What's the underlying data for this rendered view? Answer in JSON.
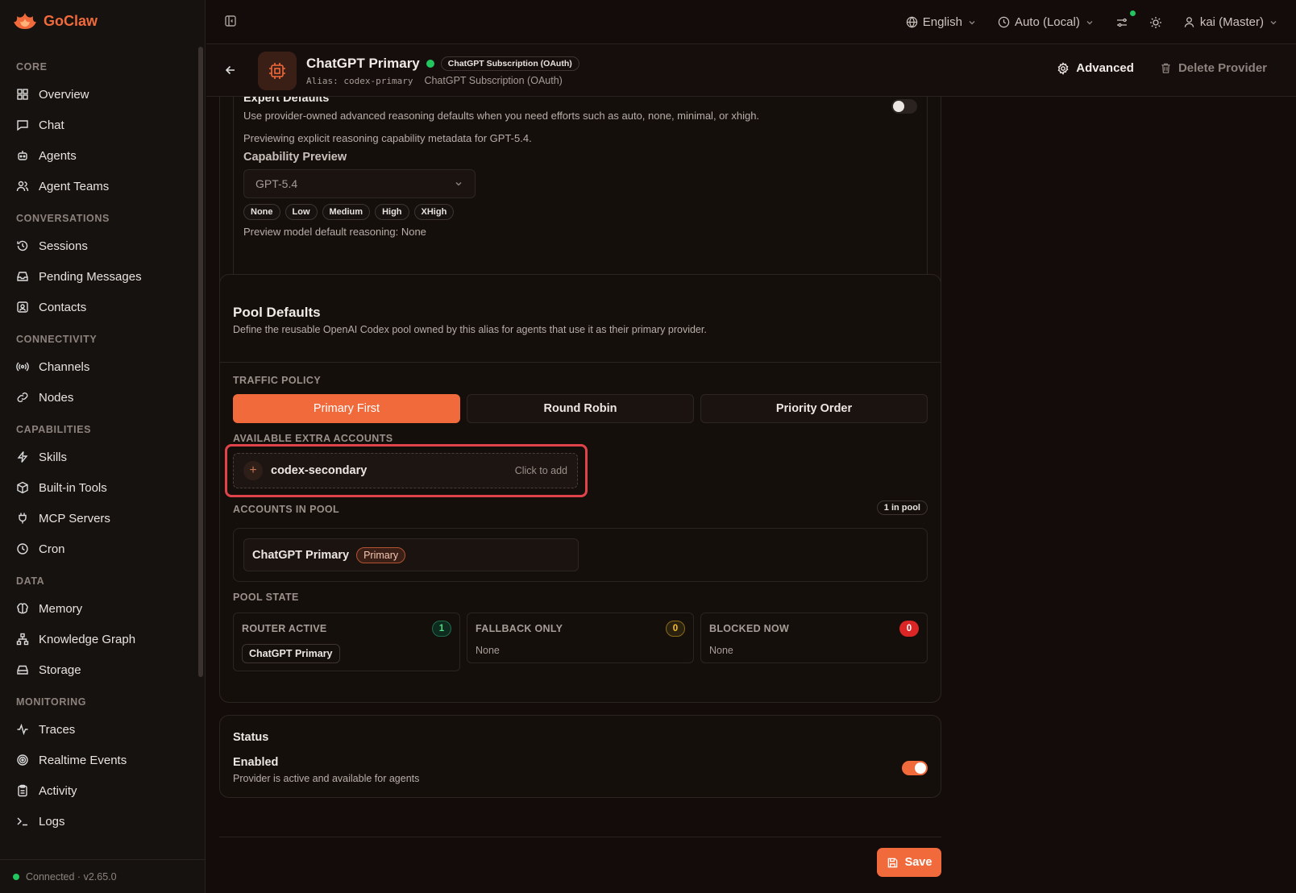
{
  "app": {
    "brand": "GoClaw",
    "connection": "Connected · v2.65.0"
  },
  "sidebar": {
    "sections": [
      {
        "title": "CORE",
        "items": [
          "Overview",
          "Chat",
          "Agents",
          "Agent Teams"
        ]
      },
      {
        "title": "CONVERSATIONS",
        "items": [
          "Sessions",
          "Pending Messages",
          "Contacts"
        ]
      },
      {
        "title": "CONNECTIVITY",
        "items": [
          "Channels",
          "Nodes"
        ]
      },
      {
        "title": "CAPABILITIES",
        "items": [
          "Skills",
          "Built-in Tools",
          "MCP Servers",
          "Cron"
        ]
      },
      {
        "title": "DATA",
        "items": [
          "Memory",
          "Knowledge Graph",
          "Storage"
        ]
      },
      {
        "title": "MONITORING",
        "items": [
          "Traces",
          "Realtime Events",
          "Activity",
          "Logs"
        ]
      }
    ]
  },
  "topbar": {
    "language": "English",
    "timezone": "Auto (Local)",
    "user": "kai (Master)"
  },
  "provider": {
    "title": "ChatGPT Primary",
    "type_badge": "ChatGPT Subscription (OAuth)",
    "alias": "Alias: codex-primary",
    "type_label": "ChatGPT Subscription (OAuth)",
    "advanced_label": "Advanced",
    "delete_label": "Delete Provider"
  },
  "reasoning": {
    "expert_title": "Expert Defaults",
    "expert_desc": "Use provider-owned advanced reasoning defaults when you need efforts such as auto, none, minimal, or xhigh.",
    "preview_note": "Previewing explicit reasoning capability metadata for GPT-5.4.",
    "capability_title": "Capability Preview",
    "selected_model": "GPT-5.4",
    "efforts": [
      "None",
      "Low",
      "Medium",
      "High",
      "XHigh"
    ],
    "default_text": "Preview model default reasoning: None"
  },
  "pool": {
    "title": "Pool Defaults",
    "description": "Define the reusable OpenAI Codex pool owned by this alias for agents that use it as their primary provider.",
    "traffic_label": "TRAFFIC POLICY",
    "policies": [
      "Primary First",
      "Round Robin",
      "Priority Order"
    ],
    "extra_label": "AVAILABLE EXTRA ACCOUNTS",
    "extra_account": "codex-secondary",
    "click_to_add": "Click to add",
    "in_pool_label": "ACCOUNTS IN POOL",
    "in_pool_count": "1 in pool",
    "member_name": "ChatGPT Primary",
    "member_badge": "Primary",
    "state_label": "POOL STATE",
    "states": [
      {
        "label": "ROUTER ACTIVE",
        "count": "1",
        "value": "ChatGPT Primary"
      },
      {
        "label": "FALLBACK ONLY",
        "count": "0",
        "value": "None"
      },
      {
        "label": "BLOCKED NOW",
        "count": "0",
        "value": "None"
      }
    ]
  },
  "status": {
    "title": "Status",
    "enabled_title": "Enabled",
    "enabled_desc": "Provider is active and available for agents"
  },
  "save_label": "Save"
}
